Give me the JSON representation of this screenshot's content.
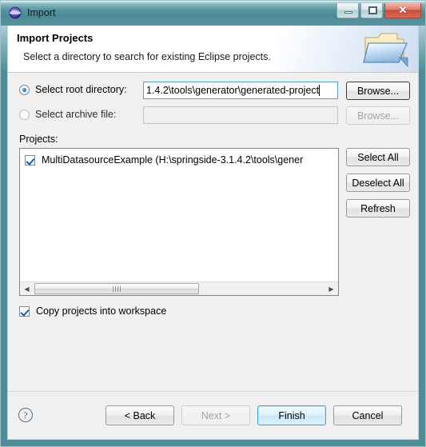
{
  "window": {
    "title": "Import",
    "app_icon": "eclipse-globe-icon",
    "controls": {
      "minimize": "minimize-icon",
      "maximize": "maximize-icon",
      "close": "✕"
    },
    "titlebar_color": "#4e8d98",
    "frame_color": "#6aa3ad"
  },
  "header": {
    "title": "Import Projects",
    "subtitle": "Select a directory to search for existing Eclipse projects.",
    "icon": "open-folder-icon"
  },
  "form": {
    "root_directory": {
      "label": "Select root directory:",
      "selected": true,
      "value": "1.4.2\\tools\\generator\\generated-project",
      "placeholder": "",
      "browse_label": "Browse...",
      "enabled": true
    },
    "archive_file": {
      "label": "Select archive file:",
      "selected": false,
      "value": "",
      "placeholder": "",
      "browse_label": "Browse...",
      "enabled": false
    }
  },
  "projects": {
    "label": "Projects:",
    "items": [
      {
        "checked": true,
        "label": "MultiDatasourceExample (H:\\springside-3.1.4.2\\tools\\gener"
      }
    ],
    "buttons": {
      "select_all": "Select All",
      "deselect_all": "Deselect All",
      "refresh": "Refresh"
    },
    "scrollbar": {
      "left_arrow": "◀",
      "right_arrow": "▶"
    }
  },
  "options": {
    "copy_into_workspace": {
      "label": "Copy projects into workspace",
      "checked": true
    }
  },
  "footer": {
    "help": "?",
    "back": "< Back",
    "next": "Next >",
    "finish": "Finish",
    "cancel": "Cancel",
    "next_enabled": false,
    "default_button": "Finish",
    "default_accent": "#2fa8e0"
  }
}
